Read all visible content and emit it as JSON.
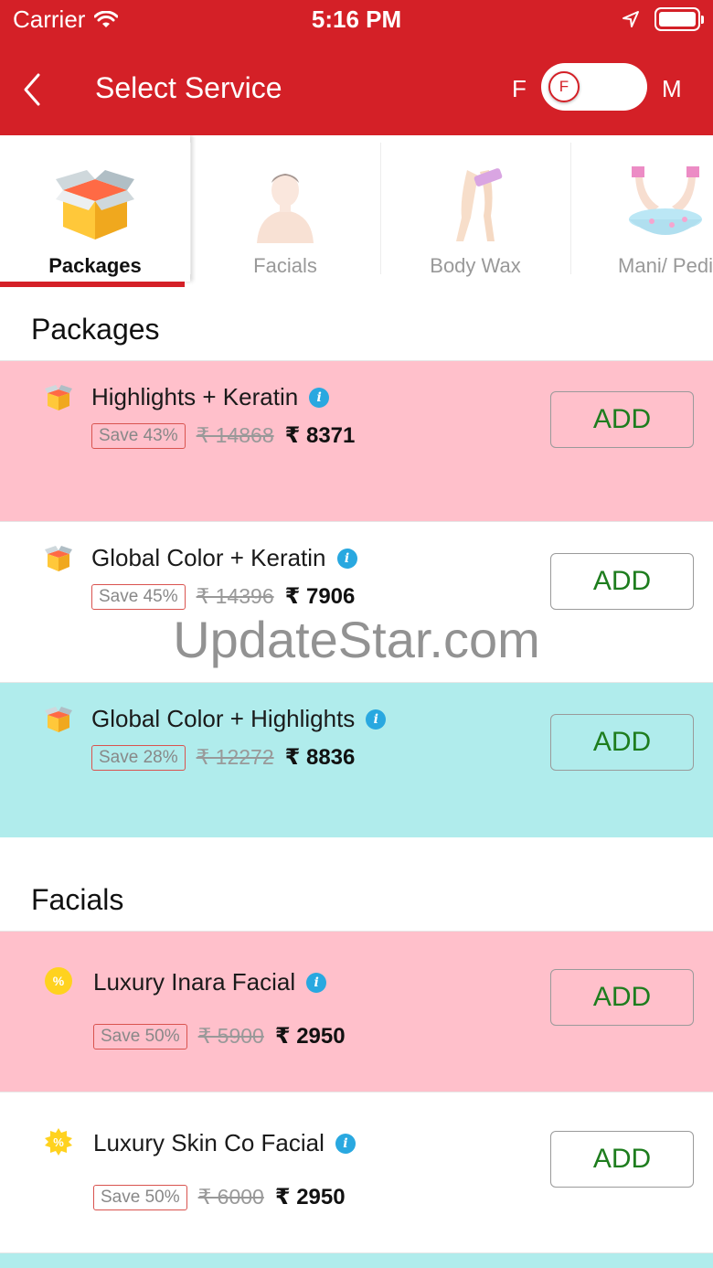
{
  "status_bar": {
    "carrier": "Carrier",
    "time": "5:16 PM"
  },
  "nav": {
    "title": "Select Service",
    "gender_left": "F",
    "gender_right": "M",
    "toggle_knob": "F"
  },
  "tabs": [
    {
      "label": "Packages",
      "active": true
    },
    {
      "label": "Facials",
      "active": false
    },
    {
      "label": "Body Wax",
      "active": false
    },
    {
      "label": "Mani/ Pedi",
      "active": false
    }
  ],
  "sections": [
    {
      "title": "Packages",
      "items": [
        {
          "name": "Highlights + Keratin",
          "save": "Save 43%",
          "old_price": "₹ 14868",
          "new_price": "₹ 8371",
          "add_label": "ADD",
          "bg": "#ffc0cb",
          "icon": "package-box-icon"
        },
        {
          "name": "Global Color + Keratin",
          "save": "Save 45%",
          "old_price": "₹ 14396",
          "new_price": "₹ 7906",
          "add_label": "ADD",
          "bg": "#ffffff",
          "icon": "package-box-icon"
        },
        {
          "name": "Global Color + Highlights",
          "save": "Save 28%",
          "old_price": "₹ 12272",
          "new_price": "₹ 8836",
          "add_label": "ADD",
          "bg": "#b0ecec",
          "icon": "package-box-icon"
        }
      ]
    },
    {
      "title": "Facials",
      "items": [
        {
          "name": "Luxury Inara Facial",
          "save": "Save 50%",
          "old_price": "₹ 5900",
          "new_price": "₹ 2950",
          "add_label": "ADD",
          "bg": "#ffc0cb",
          "icon": "discount-badge-icon"
        },
        {
          "name": "Luxury Skin Co Facial",
          "save": "Save 50%",
          "old_price": "₹ 6000",
          "new_price": "₹ 2950",
          "add_label": "ADD",
          "bg": "#ffffff",
          "icon": "discount-badge-icon"
        }
      ]
    }
  ],
  "watermark": "UpdateStar.com",
  "colors": {
    "brand_red": "#d42027",
    "add_green": "#1e7d1e",
    "info_blue": "#29a8e0"
  }
}
